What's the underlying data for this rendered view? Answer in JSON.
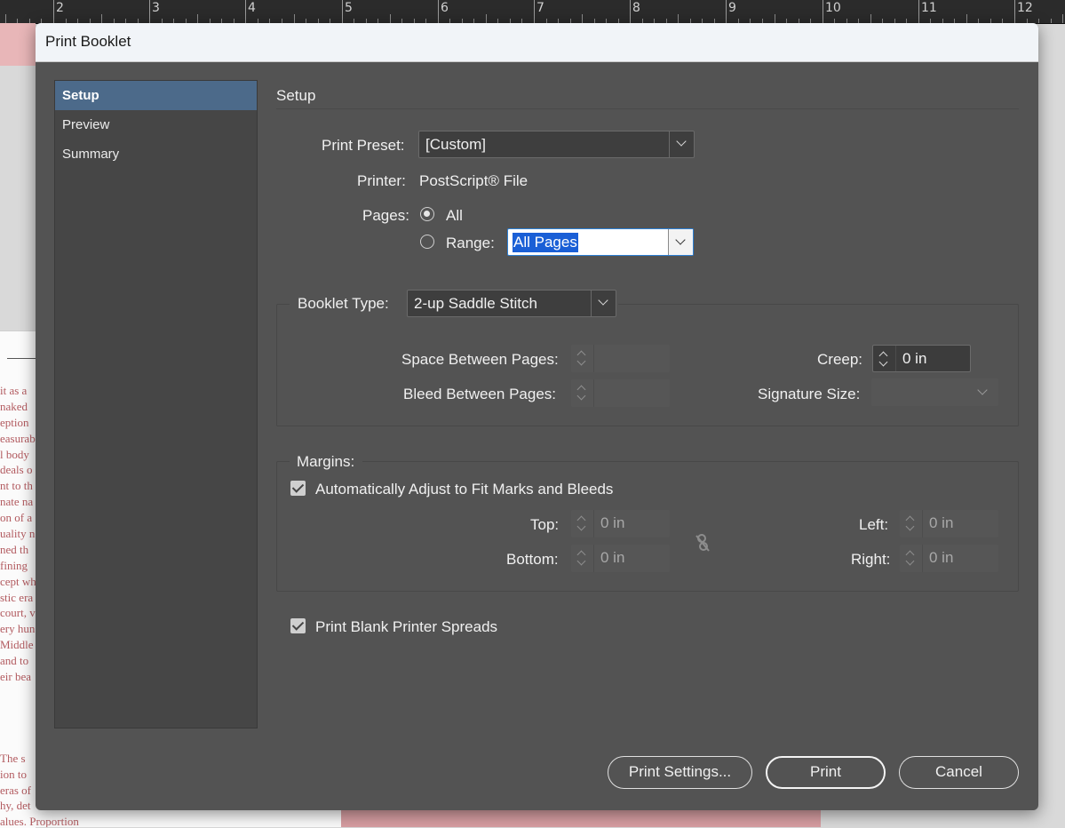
{
  "ruler": {
    "numbers": [
      "2",
      "3",
      "4",
      "5",
      "6",
      "7",
      "8",
      "9",
      "10",
      "11",
      "12"
    ]
  },
  "background_doc": {
    "lines": [
      "it as a",
      "naked",
      "eption",
      "easurab",
      "l body",
      "deals o",
      "nt to th",
      "nate na",
      "on of a",
      "uality n",
      "ned th",
      "fining",
      "cept wh",
      "stic era",
      "court, v",
      "ery hun",
      "Middle",
      "and to",
      "eir bea"
    ],
    "bottom_lines": [
      "  The  s",
      "ion  to",
      "eras  of",
      "hy,  det",
      "alues. Proportion"
    ]
  },
  "dialog": {
    "title": "Print Booklet",
    "nav": [
      {
        "label": "Setup",
        "selected": true
      },
      {
        "label": "Preview",
        "selected": false
      },
      {
        "label": "Summary",
        "selected": false
      }
    ],
    "section_title": "Setup",
    "print_preset": {
      "label": "Print Preset:",
      "value": "[Custom]"
    },
    "printer": {
      "label": "Printer:",
      "value": "PostScript® File"
    },
    "pages": {
      "label": "Pages:",
      "all_label": "All",
      "range_label": "Range:",
      "range_value": "All Pages",
      "selected": "All"
    },
    "booklet_type": {
      "label": "Booklet Type:",
      "value": "2-up Saddle Stitch"
    },
    "space_between_pages": {
      "label": "Space Between Pages:",
      "value": ""
    },
    "bleed_between_pages": {
      "label": "Bleed Between Pages:",
      "value": ""
    },
    "creep": {
      "label": "Creep:",
      "value": "0 in"
    },
    "signature_size": {
      "label": "Signature Size:",
      "value": ""
    },
    "margins": {
      "label": "Margins:",
      "auto_adjust_label": "Automatically Adjust to Fit Marks and Bleeds",
      "auto_adjust_checked": true,
      "top": {
        "label": "Top:",
        "value": "0 in"
      },
      "bottom": {
        "label": "Bottom:",
        "value": "0 in"
      },
      "left": {
        "label": "Left:",
        "value": "0 in"
      },
      "right": {
        "label": "Right:",
        "value": "0 in"
      }
    },
    "print_blank": {
      "label": "Print Blank Printer Spreads",
      "checked": true
    },
    "buttons": {
      "print_settings": "Print Settings...",
      "print": "Print",
      "cancel": "Cancel"
    }
  }
}
